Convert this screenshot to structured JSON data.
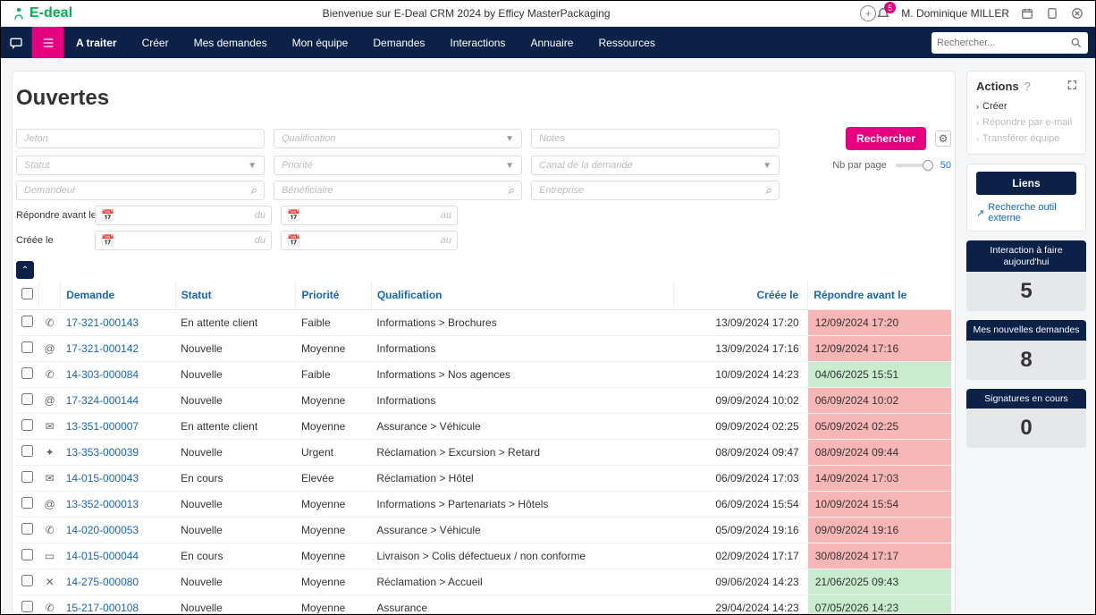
{
  "topbar": {
    "logo": "E-deal",
    "welcome": "Bienvenue sur E-Deal CRM 2024 by Efficy MasterPackaging",
    "notif_count": "5",
    "user": "M. Dominique MILLER"
  },
  "nav": {
    "items": [
      "A traiter",
      "Créer",
      "Mes demandes",
      "Mon équipe",
      "Demandes",
      "Interactions",
      "Annuaire",
      "Ressources"
    ],
    "search_placeholder": "Rechercher..."
  },
  "page_title": "Ouvertes",
  "filters": {
    "jeton": "Jeton",
    "qualification": "Qualification",
    "notes": "Notes",
    "statut": "Statut",
    "priorite": "Priorité",
    "canal": "Canal de la demande",
    "demandeur": "Demandeur",
    "beneficiaire": "Bénéficiaire",
    "entreprise": "Entreprise",
    "search_btn": "Rechercher",
    "nb_label": "Nb par page",
    "nb_value": "50",
    "rep_label": "Répondre avant le",
    "cree_label": "Créée le",
    "du": "du",
    "au": "au"
  },
  "columns": {
    "demande": "Demande",
    "statut": "Statut",
    "priorite": "Priorité",
    "qualification": "Qualification",
    "creee": "Créée le",
    "repondre": "Répondre avant le"
  },
  "rows": [
    {
      "icon": "phone",
      "ref": "17-321-000143",
      "statut": "En attente client",
      "prio": "Faible",
      "qual": "Informations > Brochures",
      "creee": "13/09/2024 17:20",
      "rep": "12/09/2024 17:20",
      "cls": "bg-red"
    },
    {
      "icon": "at",
      "ref": "17-321-000142",
      "statut": "Nouvelle",
      "prio": "Moyenne",
      "qual": "Informations",
      "creee": "13/09/2024 17:16",
      "rep": "12/09/2024 17:16",
      "cls": "bg-red"
    },
    {
      "icon": "phone",
      "ref": "14-303-000084",
      "statut": "Nouvelle",
      "prio": "Faible",
      "qual": "Informations > Nos agences",
      "creee": "10/09/2024 14:23",
      "rep": "04/06/2025 15:51",
      "cls": "bg-green"
    },
    {
      "icon": "at",
      "ref": "17-324-000144",
      "statut": "Nouvelle",
      "prio": "Moyenne",
      "qual": "Informations",
      "creee": "09/09/2024 10:02",
      "rep": "06/09/2024 10:02",
      "cls": "bg-red"
    },
    {
      "icon": "mail",
      "ref": "13-351-000007",
      "statut": "En attente client",
      "prio": "Moyenne",
      "qual": "Assurance > Véhicule",
      "creee": "09/09/2024 02:25",
      "rep": "05/09/2024 02:25",
      "cls": "bg-red"
    },
    {
      "icon": "chat",
      "ref": "13-353-000039",
      "statut": "Nouvelle",
      "prio": "Urgent",
      "qual": "Réclamation > Excursion > Retard",
      "creee": "08/09/2024 09:47",
      "rep": "08/09/2024 09:44",
      "cls": "bg-red"
    },
    {
      "icon": "mail",
      "ref": "14-015-000043",
      "statut": "En cours",
      "prio": "Elevée",
      "qual": "Réclamation > Hôtel",
      "creee": "06/09/2024 17:03",
      "rep": "14/09/2024 17:03",
      "cls": "bg-red"
    },
    {
      "icon": "at",
      "ref": "13-352-000013",
      "statut": "Nouvelle",
      "prio": "Moyenne",
      "qual": "Informations > Partenariats > Hôtels",
      "creee": "06/09/2024 15:54",
      "rep": "10/09/2024 15:54",
      "cls": "bg-red"
    },
    {
      "icon": "phone",
      "ref": "14-020-000053",
      "statut": "Nouvelle",
      "prio": "Moyenne",
      "qual": "Assurance > Véhicule",
      "creee": "05/09/2024 19:16",
      "rep": "09/09/2024 19:16",
      "cls": "bg-red"
    },
    {
      "icon": "calendar",
      "ref": "14-015-000044",
      "statut": "En cours",
      "prio": "Moyenne",
      "qual": "Livraison > Colis défectueux / non conforme",
      "creee": "02/09/2024 17:17",
      "rep": "30/08/2024 17:17",
      "cls": "bg-red"
    },
    {
      "icon": "x",
      "ref": "14-275-000080",
      "statut": "Nouvelle",
      "prio": "Moyenne",
      "qual": "Réclamation > Accueil",
      "creee": "09/06/2024 14:23",
      "rep": "21/06/2025 09:43",
      "cls": "bg-green"
    },
    {
      "icon": "phone",
      "ref": "15-217-000108",
      "statut": "Nouvelle",
      "prio": "Moyenne",
      "qual": "Assurance",
      "creee": "29/04/2024 14:23",
      "rep": "07/05/2026 14:23",
      "cls": "bg-green"
    }
  ],
  "actions": {
    "title": "Actions",
    "q": "?",
    "items": [
      {
        "label": "Créer",
        "en": true
      },
      {
        "label": "Répondre par e-mail",
        "en": false
      },
      {
        "label": "Transférer équipe",
        "en": false
      }
    ]
  },
  "links": {
    "title": "Liens",
    "ext": "Recherche outil externe"
  },
  "kpis": [
    {
      "head": "Interaction à faire aujourd'hui",
      "val": "5"
    },
    {
      "head": "Mes nouvelles demandes",
      "val": "8"
    },
    {
      "head": "Signatures en cours",
      "val": "0"
    }
  ],
  "icons": {
    "phone": "✆",
    "at": "@",
    "mail": "✉",
    "chat": "✦",
    "calendar": "▭",
    "x": "✕"
  }
}
